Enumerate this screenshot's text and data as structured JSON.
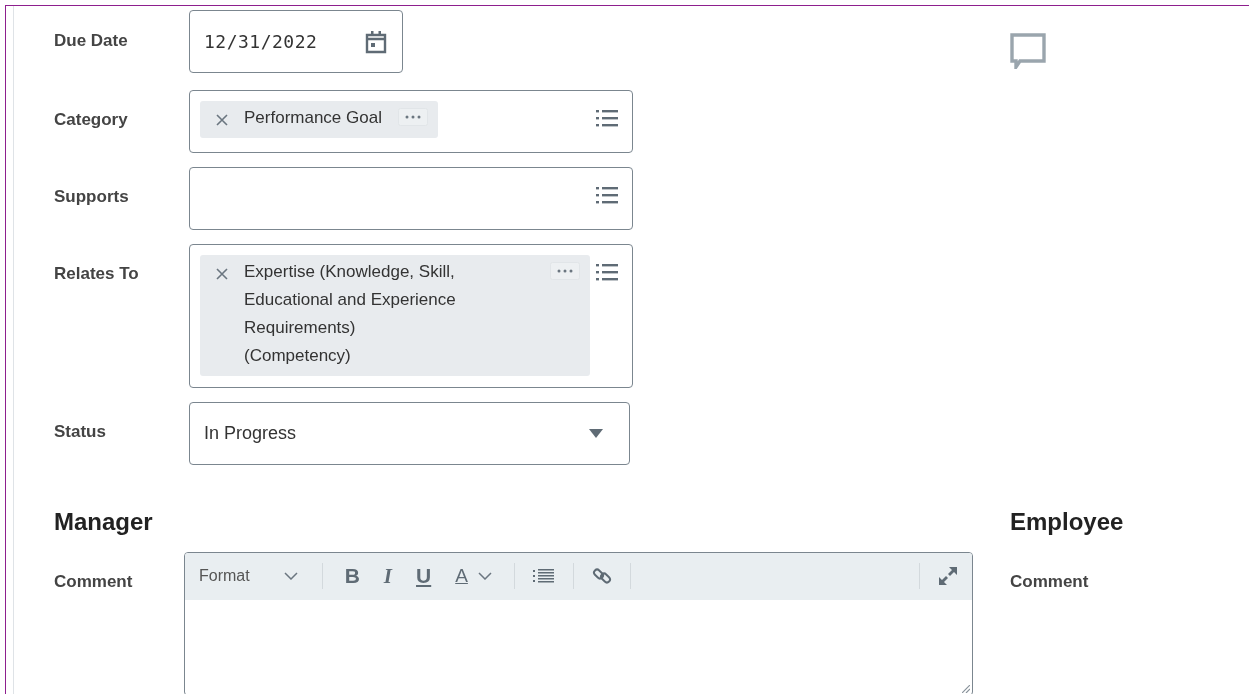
{
  "fields": [
    {
      "kind": "date",
      "label": "Due Date",
      "value": "12/31/2022"
    },
    {
      "kind": "multiselect",
      "label": "Category",
      "tokens": [
        "Performance Goal"
      ]
    },
    {
      "kind": "multiselect",
      "label": "Supports"
    },
    {
      "kind": "multiselect",
      "label": "Relates To",
      "tokens": [
        "Expertise (Knowledge, Skill, Educational and Experience Requirements)\n(Competency)"
      ]
    },
    {
      "kind": "select",
      "label": "Status",
      "value": "In Progress"
    }
  ],
  "manager": {
    "heading": "Manager",
    "comment_label": "Comment",
    "toolbar": [
      {
        "kind": "format",
        "label": "Format"
      },
      {
        "kind": "sep"
      },
      {
        "kind": "bold",
        "label": "B"
      },
      {
        "kind": "italic",
        "label": "I"
      },
      {
        "kind": "underline",
        "label": "U"
      },
      {
        "kind": "color",
        "label": "A"
      },
      {
        "kind": "sep"
      },
      {
        "kind": "list"
      },
      {
        "kind": "sep"
      },
      {
        "kind": "link"
      },
      {
        "kind": "sep"
      }
    ]
  },
  "employee": {
    "heading": "Employee",
    "comment_label": "Comment"
  }
}
